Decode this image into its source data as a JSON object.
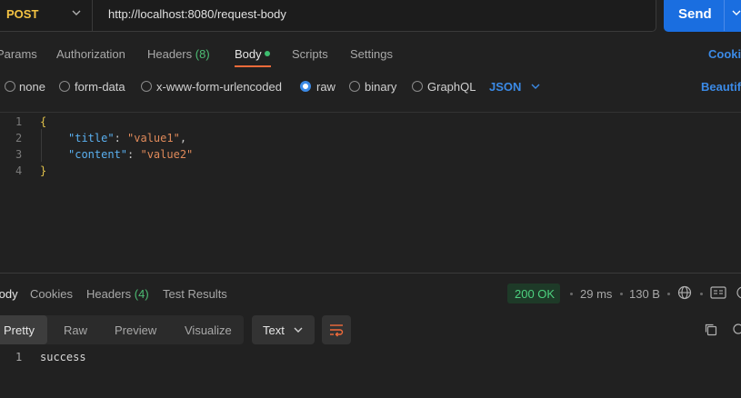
{
  "request": {
    "method": "POST",
    "url": "http://localhost:8080/request-body",
    "send_label": "Send"
  },
  "request_tabs": {
    "params": "Params",
    "authorization": "Authorization",
    "headers": "Headers",
    "headers_count": "(8)",
    "body": "Body",
    "scripts": "Scripts",
    "settings": "Settings",
    "cookies": "Cookies"
  },
  "body_types": {
    "none": "none",
    "form_data": "form-data",
    "urlencoded": "x-www-form-urlencoded",
    "raw": "raw",
    "binary": "binary",
    "graphql": "GraphQL",
    "format": "JSON",
    "beautify": "Beautify"
  },
  "editor": {
    "line_numbers": [
      "1",
      "2",
      "3",
      "4"
    ],
    "open_brace": "{",
    "close_brace": "}",
    "line2_key": "\"title\"",
    "line2_value": "\"value1\"",
    "line3_key": "\"content\"",
    "line3_value": "\"value2\"",
    "colon": ": ",
    "comma": ","
  },
  "response": {
    "tabs": {
      "body": "Body",
      "cookies": "Cookies",
      "headers": "Headers",
      "headers_count": "(4)",
      "test_results": "Test Results"
    },
    "status": "200 OK",
    "time": "29 ms",
    "size": "130 B",
    "views": {
      "pretty": "Pretty",
      "raw": "Raw",
      "preview": "Preview",
      "visualize": "Visualize"
    },
    "format": "Text",
    "line_number": "1",
    "body_text": "success"
  },
  "colors": {
    "accent": "#1a6ee0",
    "method": "#f4c343",
    "status_ok": "#4dd17f",
    "tab_underline": "#f26b3a"
  }
}
